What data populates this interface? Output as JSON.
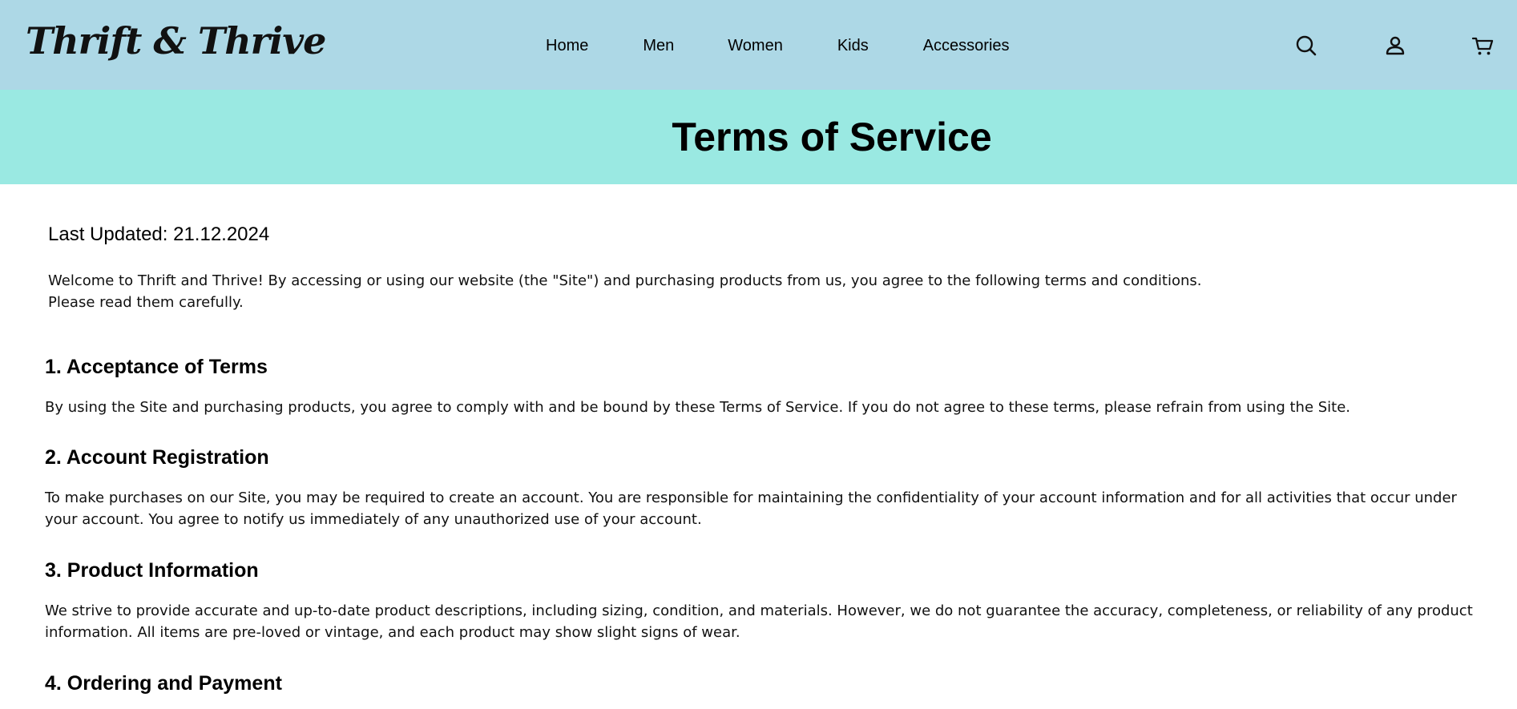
{
  "header": {
    "logo": "Thrift & Thrive",
    "nav": [
      {
        "label": "Home"
      },
      {
        "label": "Men"
      },
      {
        "label": "Women"
      },
      {
        "label": "Kids"
      },
      {
        "label": "Accessories"
      }
    ],
    "icons": [
      "search-icon",
      "user-icon",
      "cart-icon"
    ]
  },
  "hero": {
    "title": "Terms of Service"
  },
  "content": {
    "last_updated": "Last Updated: 21.12.2024",
    "intro_line1": "Welcome to Thrift and Thrive! By accessing or using our website (the \"Site\") and purchasing products from us, you agree to the following terms and conditions.",
    "intro_line2": "Please read them carefully.",
    "sections": [
      {
        "heading": "1. Acceptance of Terms",
        "body": "By using the Site and purchasing products, you agree to comply with and be bound by these Terms of Service. If you do not agree to these terms, please refrain from using the Site."
      },
      {
        "heading": "2. Account Registration",
        "body": "To make purchases on our Site, you may be required to create an account. You are responsible for maintaining the confidentiality of your account information and for all activities that occur under your account. You agree to notify us immediately of any unauthorized use of your account."
      },
      {
        "heading": "3. Product Information",
        "body": "We strive to provide accurate and up-to-date product descriptions, including sizing, condition, and materials. However, we do not guarantee the accuracy, completeness, or reliability of any product information. All items are pre-loved or vintage, and each product may show slight signs of wear."
      },
      {
        "heading": "4. Ordering and Payment",
        "body": ""
      }
    ]
  }
}
